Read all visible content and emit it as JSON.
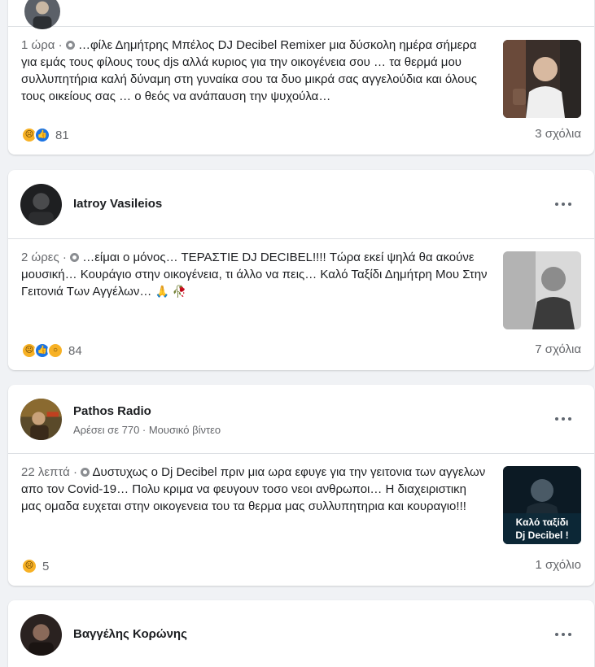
{
  "posts": [
    {
      "name": "",
      "time": "1 ώρα",
      "text": "…φίλε Δημήτρης Μπέλος DJ Decibel Remixer μια δύσκολη ημέρα σήμερα για εμάς τους φίλους τους djs αλλά κυριος για την οικογένεια σου … τα θερμά μου συλλυπητήρια καλή δύναμη στη γυναίκα σου τα δυο μικρά σας αγγελούδια και όλους τους οικείους σας … ο θεός να ανάπαυση την ψυχούλα…",
      "reactions": [
        "sad",
        "like"
      ],
      "reaction_count": "81",
      "comments": "3 σχόλια"
    },
    {
      "name": "Iatroy Vasileios",
      "time": "2 ώρες",
      "text": "…είμαι ο μόνος… ΤΕΡΑΣΤΙΕ DJ DECIBEL!!!! Τώρα εκεί ψηλά θα ακούνε μουσική… Κουράγιο στην οικογένεια, τι άλλο να πεις… Καλό Ταξίδι Δημήτρη Μου Στην Γειτονιά Των Αγγέλων…",
      "text_emoji": "🙏 🥀",
      "reactions": [
        "sad",
        "like",
        "wow"
      ],
      "reaction_count": "84",
      "comments": "7 σχόλια"
    },
    {
      "name": "Pathos Radio",
      "subline": "Αρέσει σε 770 · Μουσικό βίντεο",
      "time": "22 λεπτά",
      "text": "Δυστυχως ο Dj Decibel πριν μια ωρα εφυγε για την γειτονια των αγγελων απο τον Covid-19… Πολυ κριμα να φευγουν τοσο νεοι ανθρωποι… Η διαχειριστικη μας ομαδα ευχεται στην οικογενεια του τα θερμα μας συλλυπητηρια και κουραγιο!!!",
      "reactions": [
        "sad"
      ],
      "reaction_count": "5",
      "comments": "1 σχόλιο",
      "thumb_caption_1": "Καλό ταξίδι",
      "thumb_caption_2": "Dj Decibel !"
    },
    {
      "name": "Βαγγέλης Κορώνης"
    }
  ],
  "icons": {
    "globe": "globe-icon",
    "more": "more-options-icon",
    "sad": "sad-reaction-icon",
    "like": "like-reaction-icon",
    "wow": "wow-reaction-icon"
  },
  "colors": {
    "background": "#f0f2f5",
    "card": "#ffffff",
    "secondary_text": "#65676b",
    "like_blue": "#1b74e4",
    "emoji_yellow": "#f7b125"
  }
}
